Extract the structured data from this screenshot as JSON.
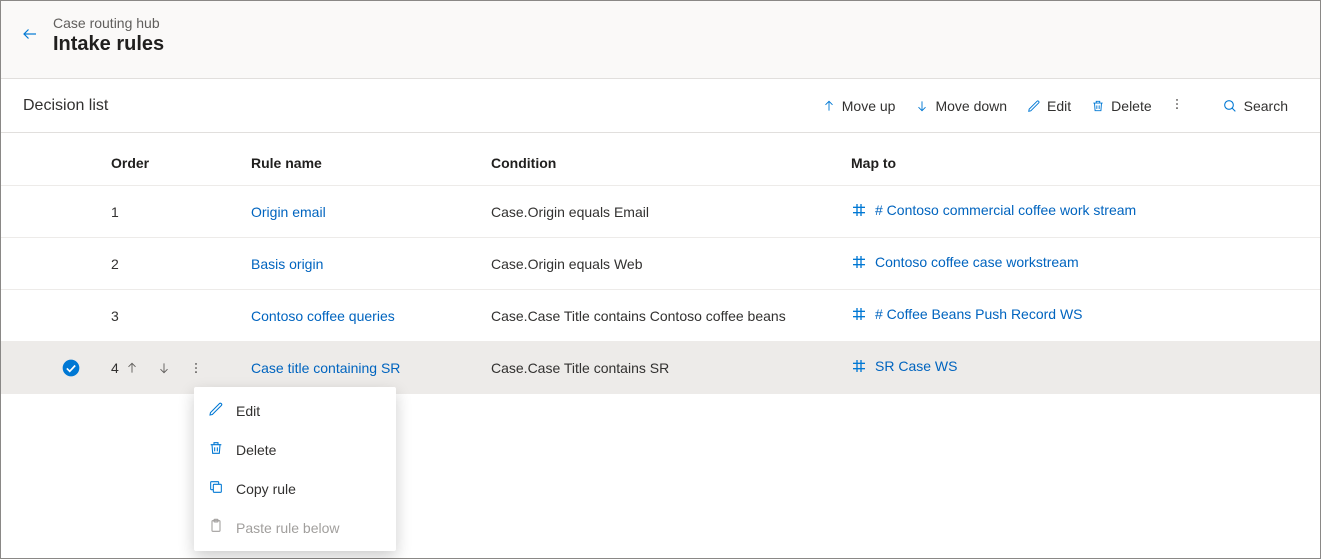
{
  "header": {
    "breadcrumb": "Case routing hub",
    "title": "Intake rules"
  },
  "toolbar": {
    "section_title": "Decision list",
    "move_up": "Move up",
    "move_down": "Move down",
    "edit": "Edit",
    "delete": "Delete",
    "search": "Search"
  },
  "columns": {
    "order": "Order",
    "rule_name": "Rule name",
    "condition": "Condition",
    "map_to": "Map to"
  },
  "rows": [
    {
      "order": "1",
      "rule_name": "Origin email",
      "condition": "Case.Origin equals Email",
      "map_to": "# Contoso commercial coffee work stream",
      "selected": false
    },
    {
      "order": "2",
      "rule_name": "Basis origin",
      "condition": "Case.Origin equals Web",
      "map_to": "Contoso coffee case workstream",
      "selected": false
    },
    {
      "order": "3",
      "rule_name": "Contoso coffee queries",
      "condition": "Case.Case Title contains Contoso coffee beans",
      "map_to": "# Coffee Beans Push Record WS",
      "selected": false
    },
    {
      "order": "4",
      "rule_name": "Case title containing SR",
      "condition": "Case.Case Title contains SR",
      "map_to": "SR Case WS",
      "selected": true
    }
  ],
  "context_menu": {
    "edit": "Edit",
    "delete": "Delete",
    "copy": "Copy rule",
    "paste": "Paste rule below"
  }
}
